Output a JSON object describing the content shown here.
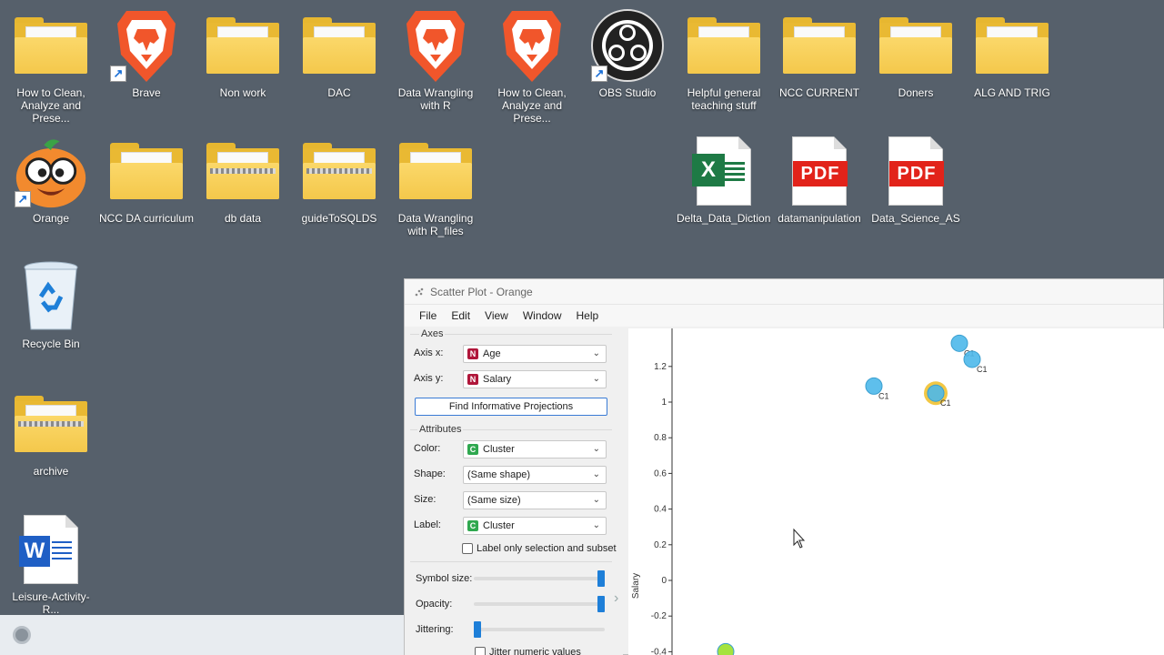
{
  "desktop": {
    "icons": [
      {
        "label": "How to Clean, Analyze and Prese...",
        "type": "folder",
        "icon": "folder-icon"
      },
      {
        "label": "Brave",
        "type": "brave",
        "icon": "brave-icon"
      },
      {
        "label": "Non work",
        "type": "folder",
        "icon": "folder-icon"
      },
      {
        "label": "DAC",
        "type": "folder",
        "icon": "folder-icon"
      },
      {
        "label": "Data Wrangling with R",
        "type": "brave",
        "icon": "brave-icon"
      },
      {
        "label": "How to Clean, Analyze and Prese...",
        "type": "brave",
        "icon": "brave-icon"
      },
      {
        "label": "OBS Studio",
        "type": "obs",
        "icon": "obs-icon"
      },
      {
        "label": "Helpful general teaching stuff",
        "type": "folder",
        "icon": "folder-icon"
      },
      {
        "label": "NCC CURRENT",
        "type": "folder",
        "icon": "folder-icon"
      },
      {
        "label": "Doners",
        "type": "folder",
        "icon": "folder-icon"
      },
      {
        "label": "ALG AND TRIG",
        "type": "folder",
        "icon": "folder-icon"
      },
      {
        "label": "Orange",
        "type": "orange",
        "icon": "orange-app-icon"
      },
      {
        "label": "NCC DA curriculum",
        "type": "folder",
        "icon": "folder-icon"
      },
      {
        "label": "db data",
        "type": "zip",
        "icon": "zip-folder-icon"
      },
      {
        "label": "guideToSQLDS",
        "type": "zip",
        "icon": "zip-folder-icon"
      },
      {
        "label": "Data Wrangling with R_files",
        "type": "folder",
        "icon": "folder-icon"
      },
      {
        "label": "Delta_Data_Diction...",
        "type": "excel",
        "icon": "excel-file-icon"
      },
      {
        "label": "datamanipulation",
        "type": "pdf",
        "icon": "pdf-file-icon"
      },
      {
        "label": "Data_Science_AS",
        "type": "pdf",
        "icon": "pdf-file-icon"
      },
      {
        "label": "Recycle Bin",
        "type": "recycle",
        "icon": "recycle-bin-icon"
      },
      {
        "label": "archive",
        "type": "zip",
        "icon": "zip-folder-icon"
      },
      {
        "label": "Leisure-Activity-R...",
        "type": "word",
        "icon": "word-file-icon"
      }
    ],
    "pdf_text": "PDF"
  },
  "window": {
    "title": "Scatter Plot - Orange",
    "menu": [
      "File",
      "Edit",
      "View",
      "Window",
      "Help"
    ]
  },
  "controls": {
    "axes_title": "Axes",
    "axis_x_label": "Axis x:",
    "axis_x_value": "Age",
    "axis_x_badge": "N",
    "axis_y_label": "Axis y:",
    "axis_y_value": "Salary",
    "axis_y_badge": "N",
    "find_projections": "Find Informative Projections",
    "attributes_title": "Attributes",
    "color_label": "Color:",
    "color_value": "Cluster",
    "color_badge": "C",
    "shape_label": "Shape:",
    "shape_value": "(Same shape)",
    "size_label": "Size:",
    "size_value": "(Same size)",
    "label_label": "Label:",
    "label_value": "Cluster",
    "label_badge": "C",
    "label_only_selection": "Label only selection and subset",
    "symbol_size_label": "Symbol size:",
    "symbol_size_level": 1.0,
    "opacity_label": "Opacity:",
    "opacity_level": 1.0,
    "jittering_label": "Jittering:",
    "jittering_level": 0.0,
    "jitter_numeric": "Jitter numeric values",
    "numeric_badge_color": "#b0163a",
    "categorical_badge_color": "#2fa84f"
  },
  "chart_data": {
    "type": "scatter",
    "ylabel": "Salary",
    "xlabel": "",
    "title": "",
    "yticks": [
      "1.2",
      "1",
      "0.8",
      "0.6",
      "0.4",
      "0.2",
      "0",
      "-0.2",
      "-0.4"
    ],
    "ylim": [
      -0.4,
      1.2
    ],
    "points": [
      {
        "y": 1.33,
        "label": "C1",
        "color": "#4cb8ea",
        "selected": false
      },
      {
        "y": 1.24,
        "label": "C1",
        "color": "#4cb8ea",
        "selected": false
      },
      {
        "y": 1.09,
        "label": "C1",
        "color": "#4cb8ea",
        "selected": false
      },
      {
        "y": 1.05,
        "label": "C1",
        "color": "#4cb8ea",
        "selected": true
      },
      {
        "y": -0.4,
        "label": "",
        "color": "#9be02a",
        "selected": false
      }
    ],
    "selection_color": "#f2c744"
  }
}
